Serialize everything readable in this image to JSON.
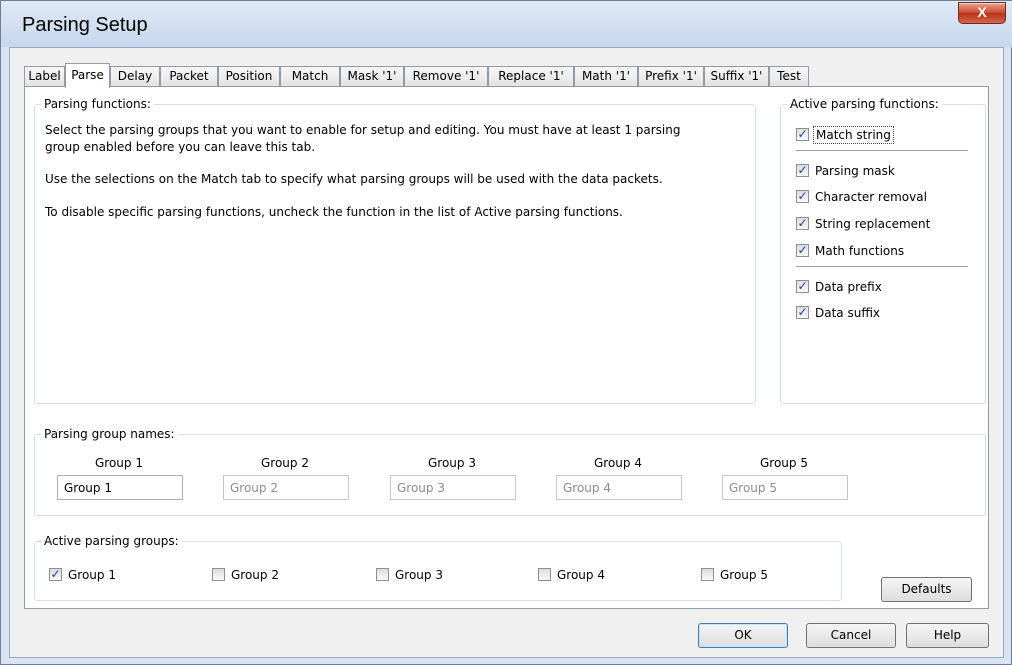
{
  "window": {
    "title": "Parsing Setup",
    "close_icon": "X"
  },
  "tabs": [
    {
      "label": "Label"
    },
    {
      "label": "Parse",
      "active": true
    },
    {
      "label": "Delay"
    },
    {
      "label": "Packet"
    },
    {
      "label": "Position"
    },
    {
      "label": "Match"
    },
    {
      "label": "Mask '1'"
    },
    {
      "label": "Remove '1'"
    },
    {
      "label": "Replace '1'"
    },
    {
      "label": "Math '1'"
    },
    {
      "label": "Prefix '1'"
    },
    {
      "label": "Suffix '1'"
    },
    {
      "label": "Test"
    }
  ],
  "parsing_functions": {
    "caption": "Parsing functions:",
    "para1_line1": "Select the parsing groups that you want to enable for setup and editing.  You must have at least 1 parsing",
    "para1_line2": "group enabled before you can leave this tab.",
    "para2": "Use the selections on the Match tab to specify what parsing groups will be used with the data packets.",
    "para3": "To disable specific parsing functions, uncheck the function in the list of Active parsing functions."
  },
  "active_functions": {
    "caption": "Active parsing functions:",
    "items": [
      {
        "label": "Match string",
        "checked": true
      },
      {
        "label": "Parsing mask",
        "checked": true
      },
      {
        "label": "Character removal",
        "checked": true
      },
      {
        "label": "String replacement",
        "checked": true
      },
      {
        "label": "Math functions",
        "checked": true
      },
      {
        "label": "Data prefix",
        "checked": true
      },
      {
        "label": "Data suffix",
        "checked": true
      }
    ]
  },
  "group_names": {
    "caption": "Parsing group names:",
    "groups": [
      {
        "header": "Group 1",
        "value": "Group 1",
        "enabled": true
      },
      {
        "header": "Group 2",
        "value": "Group 2",
        "enabled": false
      },
      {
        "header": "Group 3",
        "value": "Group 3",
        "enabled": false
      },
      {
        "header": "Group 4",
        "value": "Group 4",
        "enabled": false
      },
      {
        "header": "Group 5",
        "value": "Group 5",
        "enabled": false
      }
    ]
  },
  "active_groups": {
    "caption": "Active parsing groups:",
    "items": [
      {
        "label": "Group 1",
        "checked": true
      },
      {
        "label": "Group 2",
        "checked": false
      },
      {
        "label": "Group 3",
        "checked": false
      },
      {
        "label": "Group 4",
        "checked": false
      },
      {
        "label": "Group 5",
        "checked": false
      }
    ]
  },
  "buttons": {
    "defaults": "Defaults",
    "ok": "OK",
    "cancel": "Cancel",
    "help": "Help"
  },
  "check_mark": "✓"
}
